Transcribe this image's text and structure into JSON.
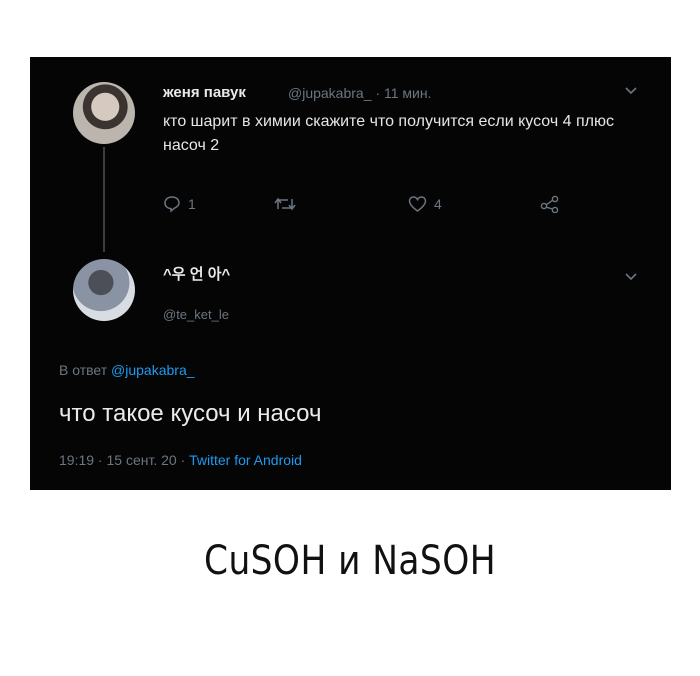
{
  "tweet": {
    "author_name": "женя павук",
    "author_handle": "@jupakabra_",
    "time": "11 мин.",
    "text": "кто шарит в химии скажите что получится если кусоч 4 плюс насоч 2",
    "reply_count": "1",
    "like_count": "4",
    "icons": [
      "reply-icon",
      "retweet-icon",
      "like-icon",
      "share-icon",
      "chevron-down-icon"
    ]
  },
  "reply": {
    "author_name": "^우 언 아^",
    "author_handle": "@te_ket_le",
    "in_reply_prefix": "В ответ",
    "in_reply_to": "@jupakabra_",
    "text": "что такое кусоч и насоч",
    "timestamp": "19:19 · 15 сент. 20 ·",
    "source": "Twitter for Android"
  },
  "caption": "CuSOH и NaSOH",
  "colors": {
    "background": "#050505",
    "muted": "#6b7681",
    "link": "#1d9bf0",
    "text": "#e6e6e6"
  }
}
